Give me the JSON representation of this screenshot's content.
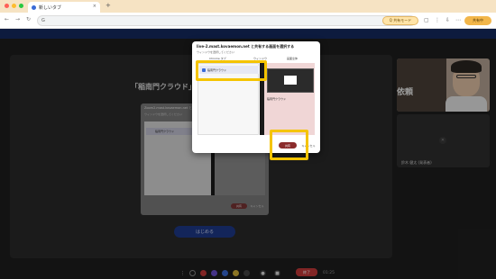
{
  "browser": {
    "tab_title": "新しいタブ",
    "tab_close": "×",
    "new_tab": "+",
    "nav_back": "←",
    "nav_forward": "→",
    "nav_reload": "↻",
    "url_text": "G",
    "url_pill": "Q 共有モード",
    "tools": [
      "▢",
      "⋮",
      "⇩",
      "⋯"
    ],
    "share_button": "共有中"
  },
  "stage": {
    "title": "「稲南門クラウド」を",
    "bottom_button": "はじめる"
  },
  "mini_dialog": {
    "title": "Zoom2.mast.kovaemon.net と共有する画面を選択する",
    "subtitle": "ウィンドウを選択してください",
    "option": "稲南門クラウド",
    "ok": "共有",
    "cancel": "キャンセル"
  },
  "dialog": {
    "title": "live-2.mast.kovaemon.net と共有する画面を選択する",
    "subtitle": "ウィンドウを選択してください",
    "tabs": [
      "Chrome タブ",
      "ウィンドウ",
      "画面全体"
    ],
    "option": "稲南門クラウド",
    "preview_label": "稲南門クラウド",
    "share_button": "共有",
    "cancel_button": "キャンセル"
  },
  "participants": {
    "presenter_poster": "依頼",
    "user_name": "鈴木 健太 (発表者)"
  },
  "toolbar": {
    "end_button": "終了",
    "timer": "01:25"
  },
  "colors": {
    "accent": "#f5c400",
    "share": "#8b2c2c",
    "end": "#c73a3a"
  }
}
